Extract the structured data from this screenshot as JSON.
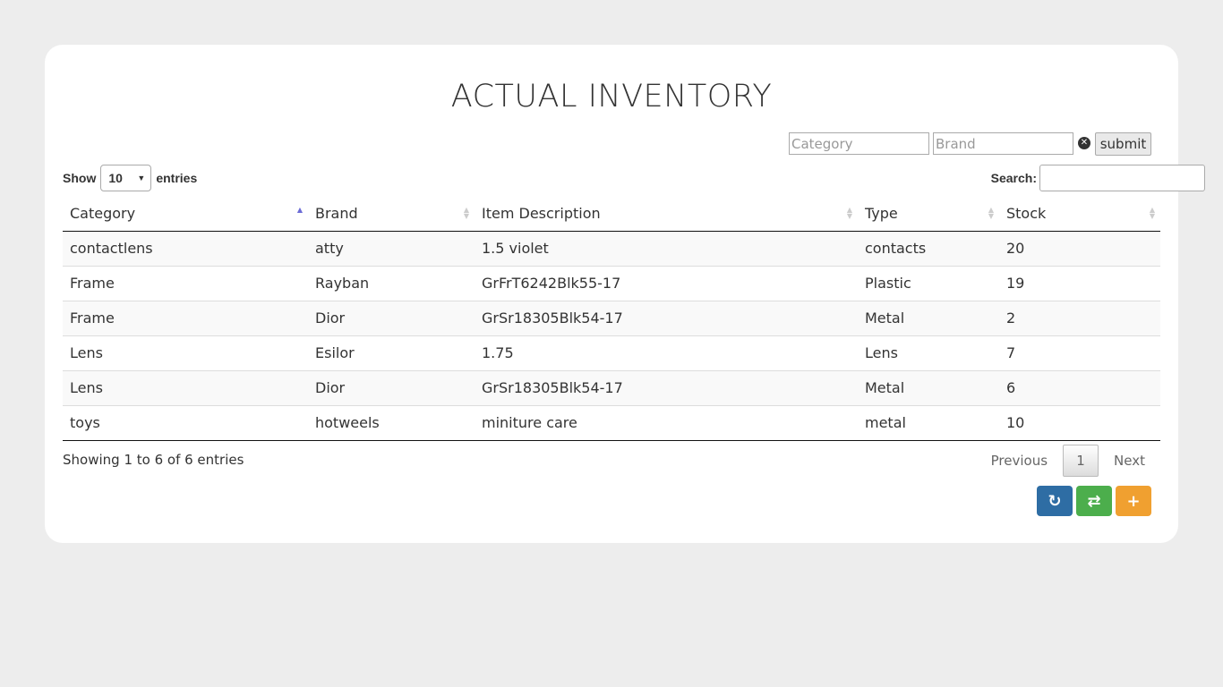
{
  "title": "ACTUAL INVENTORY",
  "filter": {
    "category_placeholder": "Category",
    "brand_placeholder": "Brand",
    "clear_icon": "times-circle-icon",
    "submit_label": "submit"
  },
  "length": {
    "show_label": "Show",
    "value": "10",
    "entries_label": "entries"
  },
  "search": {
    "label": "Search:",
    "value": ""
  },
  "table": {
    "columns": [
      "Category",
      "Brand",
      "Item Description",
      "Type",
      "Stock"
    ],
    "sorted_column": "Category",
    "rows": [
      [
        "contactlens",
        "atty",
        "1.5 violet",
        "contacts",
        "20"
      ],
      [
        "Frame",
        "Rayban",
        "GrFrT6242Blk55-17",
        "Plastic",
        "19"
      ],
      [
        "Frame",
        "Dior",
        "GrSr18305Blk54-17",
        "Metal",
        "2"
      ],
      [
        "Lens",
        "Esilor",
        "1.75",
        "Lens",
        "7"
      ],
      [
        "Lens",
        "Dior",
        "GrSr18305Blk54-17",
        "Metal",
        "6"
      ],
      [
        "toys",
        "hotweels",
        "miniture care",
        "metal",
        "10"
      ]
    ]
  },
  "info": "Showing 1 to 6 of 6 entries",
  "pagination": {
    "previous": "Previous",
    "page": "1",
    "next": "Next"
  },
  "actions": [
    {
      "name": "refresh-button",
      "icon": "refresh-icon",
      "glyph": "↻",
      "color": "#2e6da4"
    },
    {
      "name": "exchange-button",
      "icon": "exchange-icon",
      "glyph": "⇄",
      "color": "#4cae4c"
    },
    {
      "name": "add-button",
      "icon": "plus-icon",
      "glyph": "+",
      "color": "#f0a030"
    }
  ]
}
